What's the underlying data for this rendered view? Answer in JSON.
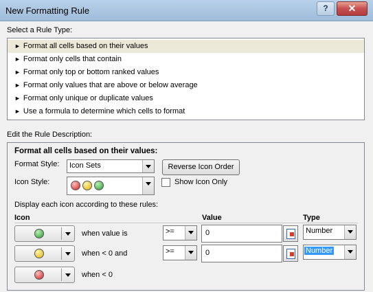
{
  "window": {
    "title": "New Formatting Rule",
    "help_label": "?",
    "close_label": "✕"
  },
  "select_rule": {
    "label": "Select a Rule Type:",
    "items": [
      {
        "label": "Format all cells based on their values"
      },
      {
        "label": "Format only cells that contain"
      },
      {
        "label": "Format only top or bottom ranked values"
      },
      {
        "label": "Format only values that are above or below average"
      },
      {
        "label": "Format only unique or duplicate values"
      },
      {
        "label": "Use a formula to determine which cells to format"
      }
    ],
    "selected": "Format all cells based on their values",
    "arrow": "►"
  },
  "edit": {
    "label": "Edit the Rule Description:",
    "heading": "Format all cells based on their values:",
    "format_style_label": "Format Style:",
    "format_style_value": "Icon Sets",
    "reverse_label": "Reverse Icon Order",
    "icon_style_label": "Icon Style:",
    "icon_style_icons": [
      "red-circle",
      "yellow-circle",
      "green-circle"
    ],
    "show_icon_only_label": "Show Icon Only",
    "show_icon_only_checked": false,
    "display_rules_label": "Display each icon according to these rules:",
    "col_icon": "Icon",
    "col_value": "Value",
    "col_type": "Type",
    "rules": [
      {
        "icon": "green-circle",
        "condition": "when value is",
        "operator": ">=",
        "value": "0",
        "type": "Number"
      },
      {
        "icon": "yellow-circle",
        "condition": "when < 0 and",
        "operator": ">=",
        "value": "0",
        "type": "Number"
      },
      {
        "icon": "red-circle",
        "condition": "when < 0"
      }
    ]
  },
  "colors": {
    "title_bar": "#b9d1ea",
    "close_button": "#c75050",
    "selection_highlight": "#3399ff"
  }
}
